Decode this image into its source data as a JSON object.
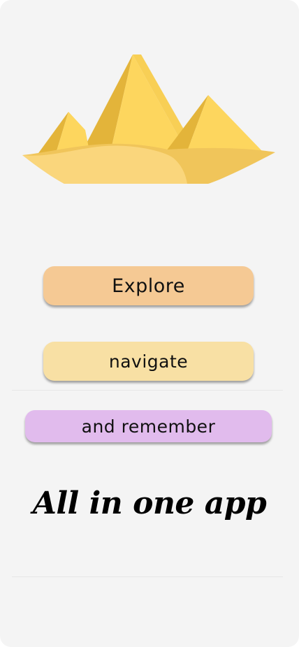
{
  "logo": {
    "icon": "desert-pyramids-icon"
  },
  "actions": {
    "explore_label": "Explore",
    "navigate_label": "navigate",
    "remember_label": "and remember"
  },
  "tagline": "All in one app",
  "colors": {
    "screen_bg": "#f4f4f4",
    "explore_bg": "#f5c994",
    "navigate_bg": "#f8e0a4",
    "remember_bg": "#e1bbed",
    "pyramid_light": "#fdd65e",
    "pyramid_dark": "#e3b43a",
    "sand_light": "#fad67c",
    "sand_dark": "#f0c55a"
  }
}
